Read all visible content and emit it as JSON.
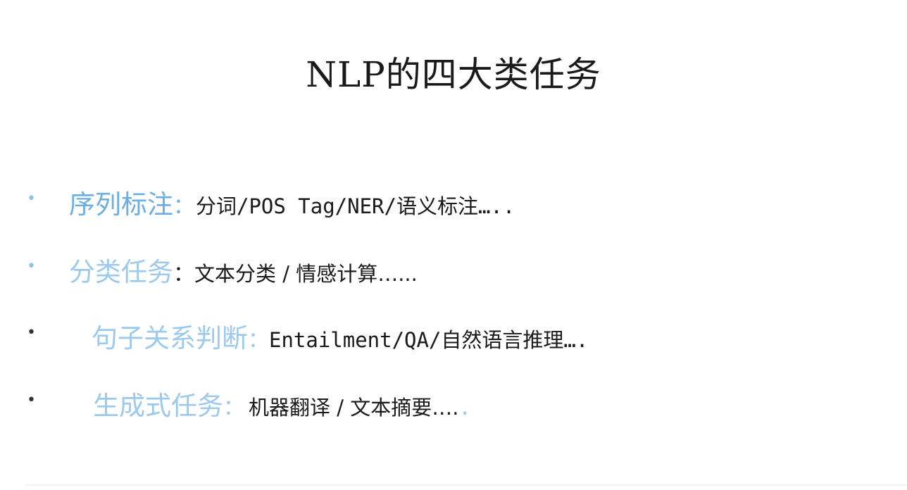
{
  "title": "NLP的四大类任务",
  "items": [
    {
      "bullet": "•",
      "term": "序列标注",
      "colon": "：",
      "detail": "分词/POS Tag/NER/语义标注…..",
      "trail": ""
    },
    {
      "bullet": "•",
      "term": "分类任务",
      "colon": "：",
      "detail": "文本分类 / 情感计算…...",
      "trail": ""
    },
    {
      "bullet": "•",
      "term": "句子关系判断",
      "colon": "：",
      "detail": "Entailment/QA/自然语言推理….",
      "trail": ""
    },
    {
      "bullet": "•",
      "term": "生成式任务",
      "colon": "：",
      "detail": "机器翻译 / 文本摘要….",
      "trail": "."
    }
  ],
  "colors": {
    "term_blue": "#6aaee3",
    "term_pale_blue": "#9ccaee",
    "text": "#1a1a1a"
  }
}
